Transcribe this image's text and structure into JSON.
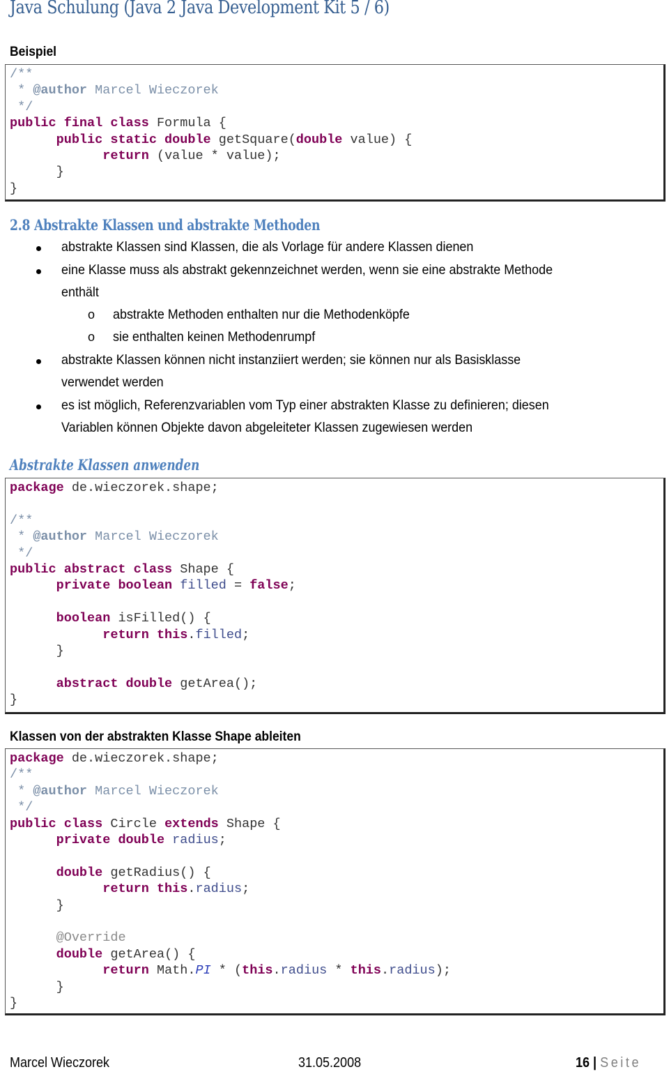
{
  "header": {
    "title": "Java Schulung (Java 2 Java Development Kit 5 / 6)"
  },
  "example": {
    "heading": "Beispiel",
    "code": {
      "l1": "/**",
      "l2_star": " * ",
      "l2_tag": "@author",
      "l2_name": " Marcel Wieczorek",
      "l3": " */",
      "l4_kw": "public final class",
      "l4_rest": " Formula {",
      "l5_indent": "      ",
      "l5_kw1": "public static double",
      "l5_mid": " getSquare(",
      "l5_kw2": "double",
      "l5_rest": " value) {",
      "l6_indent": "            ",
      "l6_kw": "return",
      "l6_rest": " (value * value);",
      "l7": "      }",
      "l8": "}"
    }
  },
  "section": {
    "heading": "2.8 Abstrakte Klassen und abstrakte Methoden",
    "bullets": [
      {
        "text": "abstrakte Klassen sind Klassen, die als Vorlage für andere Klassen dienen"
      },
      {
        "line1": "eine Klasse muss als abstrakt gekennzeichnet werden, wenn sie eine abstrakte Methode",
        "line2": "enthält"
      },
      {
        "line1": "abstrakte Klassen können nicht instanziiert werden; sie können nur als Basisklasse",
        "line2": "verwendet werden"
      },
      {
        "line1": "es ist möglich, Referenzvariablen vom Typ einer abstrakten Klasse zu definieren; diesen",
        "line2": "Variablen können Objekte davon abgeleiteter Klassen zugewiesen werden"
      }
    ],
    "sub_bullets": [
      {
        "marker": "o",
        "text": "abstrakte Methoden enthalten nur die Methodenköpfe"
      },
      {
        "marker": "o",
        "text": "sie enthalten keinen Methodenrumpf"
      }
    ]
  },
  "shape": {
    "heading": "Abstrakte Klassen anwenden",
    "code": {
      "pkg_kw": "package",
      "pkg_rest": " de.wieczorek.shape;",
      "c1": "/**",
      "c2_star": " * ",
      "c2_tag": "@author",
      "c2_name": " Marcel Wieczorek",
      "c3": " */",
      "cls_kw": "public abstract class",
      "cls_rest": " Shape {",
      "f_indent": "      ",
      "f_kw": "private boolean",
      "f_sp": " ",
      "f_name": "filled",
      "f_eq": " = ",
      "f_val": "false",
      "f_end": ";",
      "m_indent": "      ",
      "m_kw": "boolean",
      "m_rest": " isFilled() {",
      "r_indent": "            ",
      "r_kw": "return this",
      "r_dot": ".",
      "r_fld": "filled",
      "r_end": ";",
      "m_close": "      }",
      "a_indent": "      ",
      "a_kw": "abstract double",
      "a_rest": " getArea();",
      "close": "}"
    }
  },
  "circle": {
    "heading": "Klassen von der abstrakten Klasse Shape ableiten",
    "code": {
      "pkg_kw": "package",
      "pkg_rest": " de.wieczorek.shape;",
      "c1": "/**",
      "c2_star": " * ",
      "c2_tag": "@author",
      "c2_name": " Marcel Wieczorek",
      "c3": " */",
      "cls_kw1": "public class",
      "cls_mid": " Circle ",
      "cls_kw2": "extends",
      "cls_rest": " Shape {",
      "f_indent": "      ",
      "f_kw": "private double",
      "f_sp": " ",
      "f_name": "radius",
      "f_end": ";",
      "g_indent": "      ",
      "g_kw": "double",
      "g_rest": " getRadius() {",
      "gr_indent": "            ",
      "gr_kw": "return this",
      "gr_dot": ".",
      "gr_fld": "radius",
      "gr_end": ";",
      "g_close": "      }",
      "ann_indent": "      ",
      "ann": "@Override",
      "a_indent": "      ",
      "a_kw": "double",
      "a_rest": " getArea() {",
      "ar_indent": "            ",
      "ar_kw": "return",
      "ar_math": " Math.",
      "ar_pi": "PI",
      "ar_op": " * (",
      "ar_this1": "this",
      "ar_dot1": ".",
      "ar_fld1": "radius",
      "ar_mul": " * ",
      "ar_this2": "this",
      "ar_dot2": ".",
      "ar_fld2": "radius",
      "ar_end": ");",
      "a_close": "      }",
      "close": "}"
    }
  },
  "footer": {
    "author": "Marcel Wieczorek",
    "date": "31.05.2008",
    "page_number": "16",
    "separator": "|",
    "page_word": "Seite"
  }
}
